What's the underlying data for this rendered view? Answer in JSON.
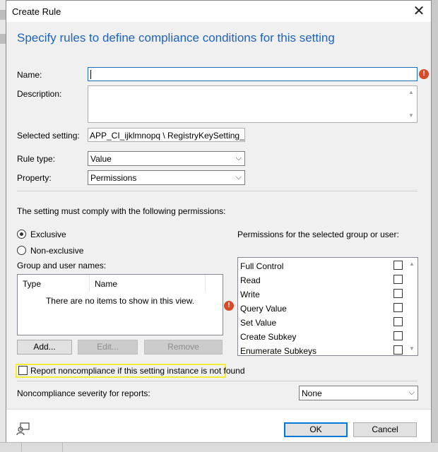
{
  "dialog": {
    "title": "Create Rule",
    "close_glyph": "✕",
    "heading": "Specify rules to define compliance conditions for this setting"
  },
  "form": {
    "name_label": "Name:",
    "name_value": "",
    "description_label": "Description:",
    "description_value": "",
    "selected_setting_label": "Selected setting:",
    "selected_setting_value": "APP_CI_ijklmnopq \\ RegistryKeySetting_andn",
    "rule_type_label": "Rule type:",
    "rule_type_value": "Value",
    "property_label": "Property:",
    "property_value": "Permissions"
  },
  "permissions_section": {
    "intro": "The setting must comply with the following permissions:",
    "exclusive_label": "Exclusive",
    "nonexclusive_label": "Non-exclusive",
    "selected_option": "Exclusive",
    "group_label": "Group and user names:",
    "columns": [
      "Type",
      "Name"
    ],
    "empty_text": "There are no items to show in this view.",
    "add_label": "Add...",
    "edit_label": "Edit...",
    "remove_label": "Remove",
    "perm_header": "Permissions for the selected group or user:",
    "permissions": [
      {
        "label": "Full Control",
        "checked": false
      },
      {
        "label": "Read",
        "checked": false
      },
      {
        "label": "Write",
        "checked": false
      },
      {
        "label": "Query Value",
        "checked": false
      },
      {
        "label": "Set Value",
        "checked": false
      },
      {
        "label": "Create Subkey",
        "checked": false
      },
      {
        "label": "Enumerate Subkeys",
        "checked": false
      }
    ]
  },
  "report": {
    "label": "Report noncompliance if this setting instance is not found",
    "checked": false
  },
  "severity": {
    "label": "Noncompliance severity for reports:",
    "value": "None"
  },
  "footer": {
    "ok_label": "OK",
    "cancel_label": "Cancel"
  },
  "icons": {
    "error": "error-icon",
    "dropdown": "chevron-down-icon",
    "help": "help-icon"
  },
  "colors": {
    "heading": "#1f63b8",
    "error": "#d64b2a",
    "focus": "#1a6fc0",
    "highlight": "#f4ee3a"
  }
}
